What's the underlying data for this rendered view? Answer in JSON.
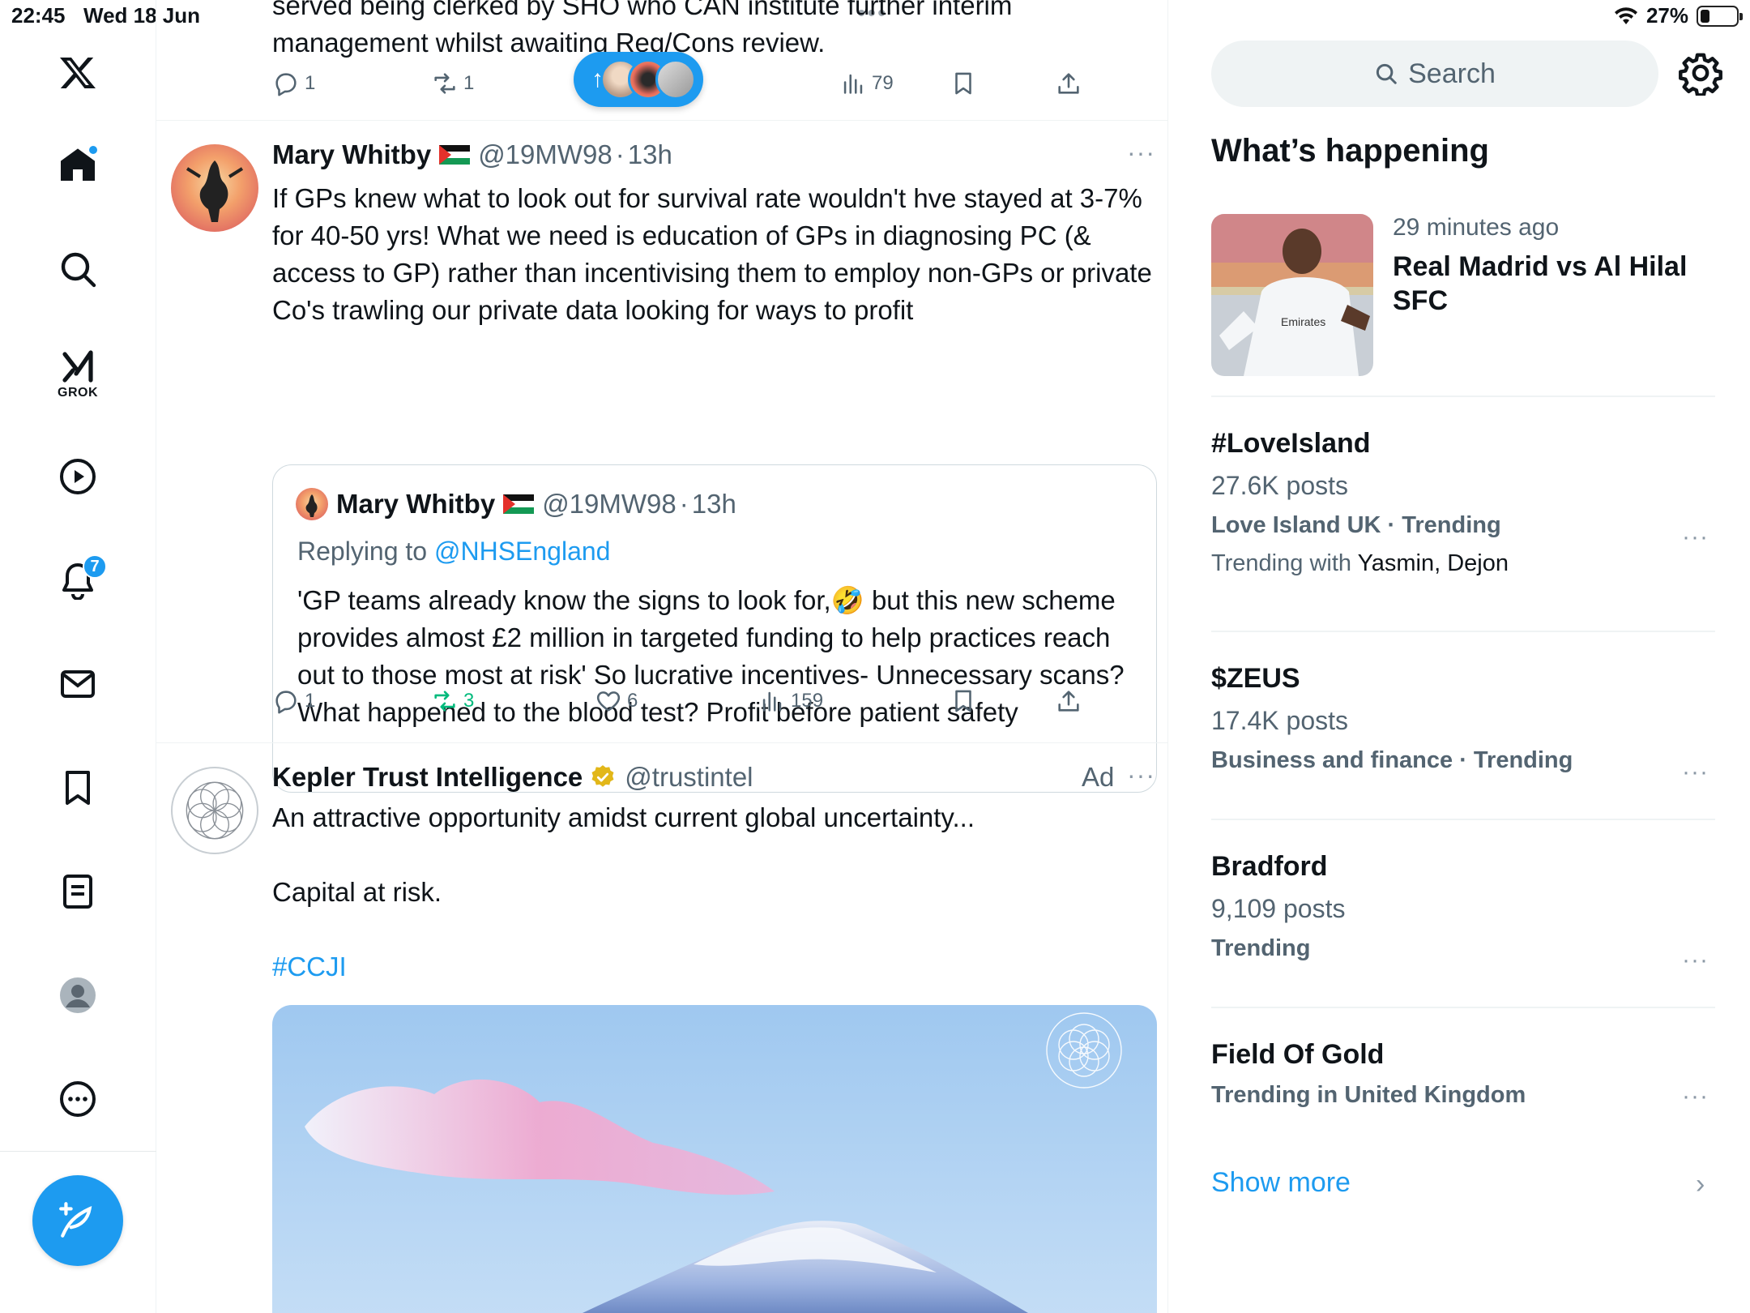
{
  "status_bar": {
    "time": "22:45",
    "date": "Wed 18 Jun",
    "battery": "27%",
    "battery_level": 0.27
  },
  "nav": {
    "grok_label": "GROK",
    "notifications_count": "7"
  },
  "timeline": {
    "previous_tweet_text": "served being clerked by SHO who CAN institute further interim management whilst awaiting Reg/Cons review.",
    "previous_actions": {
      "replies": "1",
      "reposts": "1",
      "views": "79"
    },
    "tweet1": {
      "name": "Mary Whitby",
      "handle": "@19MW98",
      "time": "13h",
      "text": "If GPs knew what to look out for survival rate wouldn't hve stayed at 3-7% for 40-50 yrs! What we need is education of GPs in diagnosing PC (& access to GP) rather than incentivising them to employ non-GPs or private Co's trawling our private data looking for ways to profit",
      "quote": {
        "name": "Mary Whitby",
        "handle": "@19MW98",
        "time": "13h",
        "replying_label": "Replying to",
        "replying_to": "@NHSEngland",
        "text": "'GP teams already know the signs to look for,🤣 but this new scheme provides almost £2 million in targeted funding to help practices reach out to those most at risk' So lucrative incentives- Unnecessary scans? What happened to the blood test? Profit before patient safety"
      },
      "actions": {
        "replies": "1",
        "reposts": "3",
        "likes": "6",
        "views": "159"
      }
    },
    "tweet2": {
      "name": "Kepler Trust Intelligence",
      "handle": "@trustintel",
      "ad_label": "Ad",
      "line1": "An attractive opportunity amidst current global uncertainty...",
      "line2": "Capital at risk.",
      "hashtag": "#CCJI"
    }
  },
  "sidebar": {
    "search_placeholder": "Search",
    "title": "What’s happening",
    "featured": {
      "time": "29 minutes ago",
      "headline": "Real Madrid vs Al Hilal SFC"
    },
    "trends": [
      {
        "name": "#LoveIsland",
        "posts": "27.6K posts",
        "context": "Love Island UK · Trending",
        "with_label": "Trending with",
        "with": "Yasmin, Dejon"
      },
      {
        "name": "$ZEUS",
        "posts": "17.4K posts",
        "context": "Business and finance · Trending"
      },
      {
        "name": "Bradford",
        "posts": "9,109 posts",
        "context": "Trending"
      },
      {
        "name": "Field Of Gold",
        "context": "Trending in United Kingdom"
      }
    ],
    "show_more": "Show more"
  },
  "colors": {
    "accent": "#1d9bf0",
    "repost_green": "#00ba7c",
    "secondary_text": "#536471"
  }
}
